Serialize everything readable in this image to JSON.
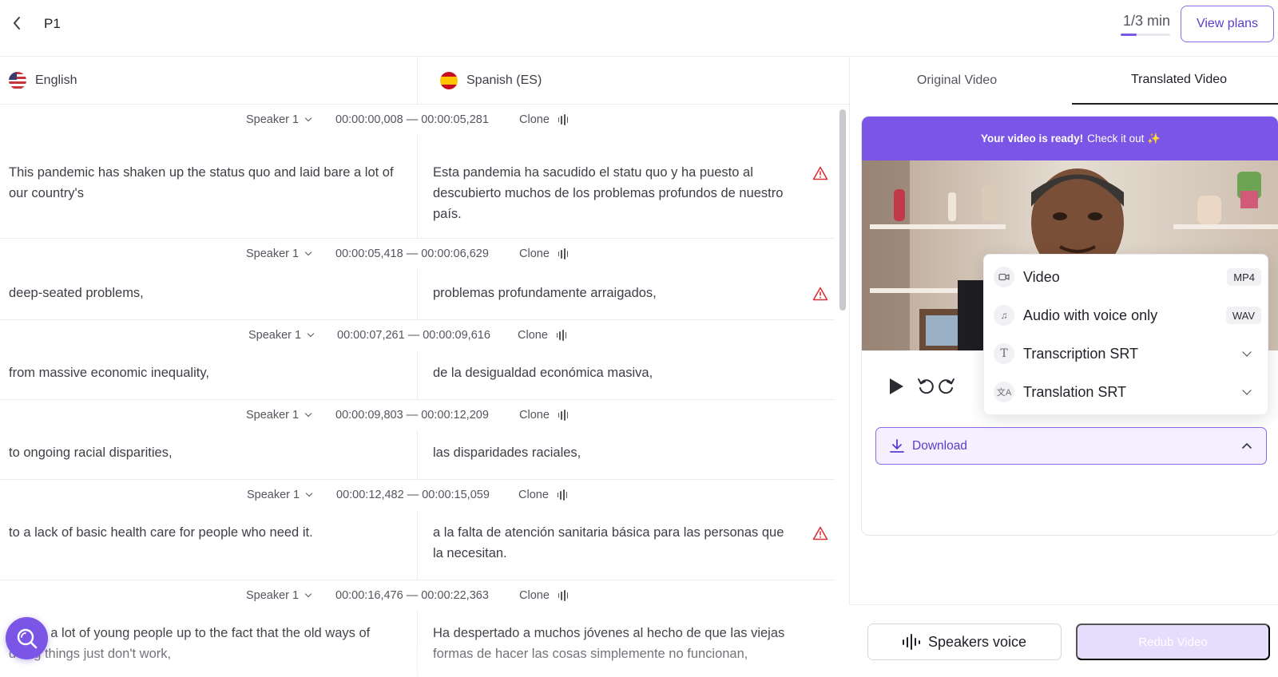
{
  "topbar": {
    "back_icon": "chevron-left-icon",
    "title": "P1",
    "usage_text": "1/3 min",
    "usage_progress": 0.33,
    "view_plans_label": "View plans"
  },
  "languages": {
    "source": {
      "name": "English",
      "flag": "us-flag-icon"
    },
    "target": {
      "name": "Spanish (ES)",
      "flag": "es-flag-icon"
    }
  },
  "segments": [
    {
      "speaker": "Speaker 1",
      "time": "00:00:00,008 — 00:00:05,281",
      "clone": "Clone",
      "source": "This pandemic has shaken up the status quo and laid bare a lot of our country's",
      "target": "Esta pandemia ha sacudido el statu quo y ha puesto al descubierto muchos de los problemas profundos de nuestro país.",
      "warning": true
    },
    {
      "speaker": "Speaker 1",
      "time": "00:00:05,418 — 00:00:06,629",
      "clone": "Clone",
      "source": "deep-seated problems,",
      "target": "problemas profundamente arraigados,",
      "warning": true
    },
    {
      "speaker": "Speaker 1",
      "time": "00:00:07,261 — 00:00:09,616",
      "clone": "Clone",
      "source": "from massive economic inequality,",
      "target": "de la desigualdad económica masiva,",
      "warning": false
    },
    {
      "speaker": "Speaker 1",
      "time": "00:00:09,803 — 00:00:12,209",
      "clone": "Clone",
      "source": "to ongoing racial disparities,",
      "target": "las disparidades raciales,",
      "warning": false
    },
    {
      "speaker": "Speaker 1",
      "time": "00:00:12,482 — 00:00:15,059",
      "clone": "Clone",
      "source": "to a lack of basic health care for people who need it.",
      "target": "a la falta de atención sanitaria básica para las personas que la necesitan.",
      "warning": true
    },
    {
      "speaker": "Speaker 1",
      "time": "00:00:16,476 — 00:00:22,363",
      "clone": "Clone",
      "source": "woken a lot of young people up to the fact that the old ways of doing things just don't work,",
      "target": "Ha despertado a muchos jóvenes al hecho de que las viejas formas de hacer las cosas simplemente no funcionan,",
      "warning": false
    }
  ],
  "tabs": {
    "original": "Original Video",
    "translated": "Translated Video",
    "active": "translated"
  },
  "video": {
    "banner_bold": "Your video is ready!",
    "banner_text": "Check it out ✨"
  },
  "download_menu": {
    "items": [
      {
        "label": "Video",
        "badge": "MP4",
        "icon": "video-camera-icon"
      },
      {
        "label": "Audio with voice only",
        "badge": "WAV",
        "icon": "music-note-icon"
      },
      {
        "label": "Transcription SRT",
        "icon": "text-t-icon"
      },
      {
        "label": "Translation SRT",
        "icon": "translate-icon"
      }
    ],
    "button_label": "Download"
  },
  "footer": {
    "speakers_voice_label": "Speakers voice",
    "redub_label": "Redub Video"
  },
  "colors": {
    "accent": "#7a55e6",
    "accent_border": "#8c6ae6",
    "warning": "#d8323a",
    "redub_disabled": "#e6dcfb"
  }
}
